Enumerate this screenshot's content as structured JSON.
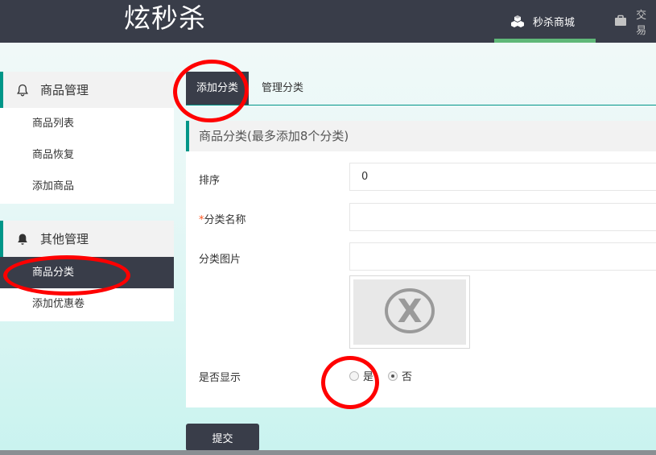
{
  "header": {
    "brand": "炫秒杀",
    "nav": [
      {
        "label": "秒杀商城",
        "icon": "cubes-icon"
      },
      {
        "label": "交易",
        "icon": "briefcase-icon"
      }
    ]
  },
  "sidebar": {
    "groups": [
      {
        "title": "商品管理",
        "icon": "bell-outline-icon",
        "items": [
          "商品列表",
          "商品恢复",
          "添加商品"
        ]
      },
      {
        "title": "其他管理",
        "icon": "bell-solid-icon",
        "items": [
          "商品分类",
          "添加优惠卷"
        ],
        "active_item": "商品分类"
      }
    ]
  },
  "tabs": [
    "添加分类",
    "管理分类"
  ],
  "form": {
    "title": "商品分类(最多添加8个分类)",
    "fields": {
      "sort": {
        "label": "排序",
        "value": "0"
      },
      "name": {
        "label": "分类名称",
        "required_mark": "*",
        "value": ""
      },
      "image": {
        "label": "分类图片",
        "value": ""
      },
      "display": {
        "label": "是否显示",
        "options": [
          "是",
          "否"
        ],
        "selected": "否"
      }
    },
    "submit_label": "提交"
  },
  "colors": {
    "dark": "#393d49",
    "accent": "#009688",
    "nav_indicator": "#5fb878",
    "annotation": "#ff0000"
  }
}
